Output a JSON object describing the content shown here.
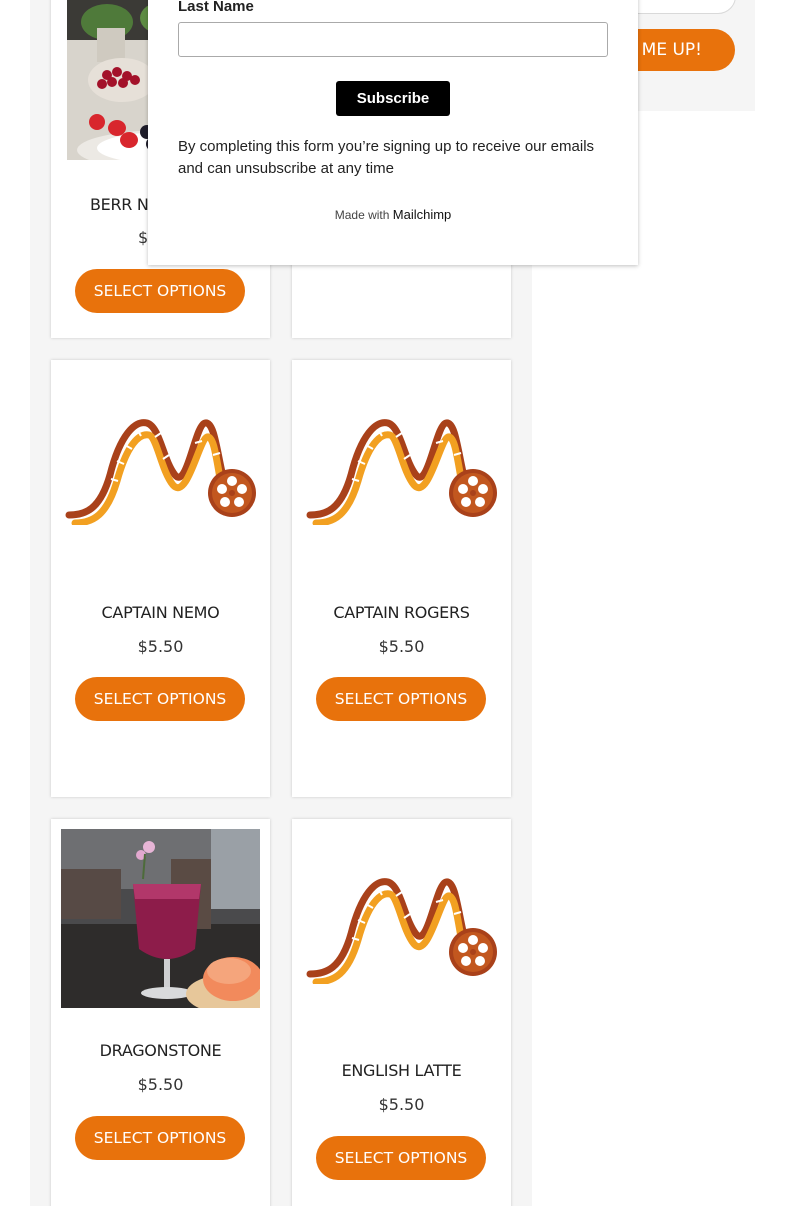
{
  "sidebar": {
    "signup_button_label": "SIGN ME UP!"
  },
  "popup": {
    "last_name_label": "Last Name",
    "last_name_value": "",
    "subscribe_label": "Subscribe",
    "disclaimer": "By completing this form you’re signing up to receive our emails and can unsubscribe at any time",
    "made_with": "Made with",
    "mailchimp": "Mailchimp"
  },
  "products": [
    {
      "name": "BERR N",
      "price": "$",
      "button": "SELECT OPTIONS",
      "image": "berries-photo"
    },
    {
      "name": "",
      "price": "",
      "button": "",
      "image": "none"
    },
    {
      "name": "CAPTAIN NEMO",
      "price": "$5.50",
      "button": "SELECT OPTIONS",
      "image": "film-reel-logo"
    },
    {
      "name": "CAPTAIN ROGERS",
      "price": "$5.50",
      "button": "SELECT OPTIONS",
      "image": "film-reel-logo"
    },
    {
      "name": "DRAGONSTONE",
      "price": "$5.50",
      "button": "SELECT OPTIONS",
      "image": "drink-photo"
    },
    {
      "name": "ENGLISH LATTE",
      "price": "$5.50",
      "button": "SELECT OPTIONS",
      "image": "film-reel-logo"
    }
  ],
  "colors": {
    "accent": "#e8720c",
    "logo_dark": "#a9411a",
    "logo_light": "#f2a021"
  }
}
